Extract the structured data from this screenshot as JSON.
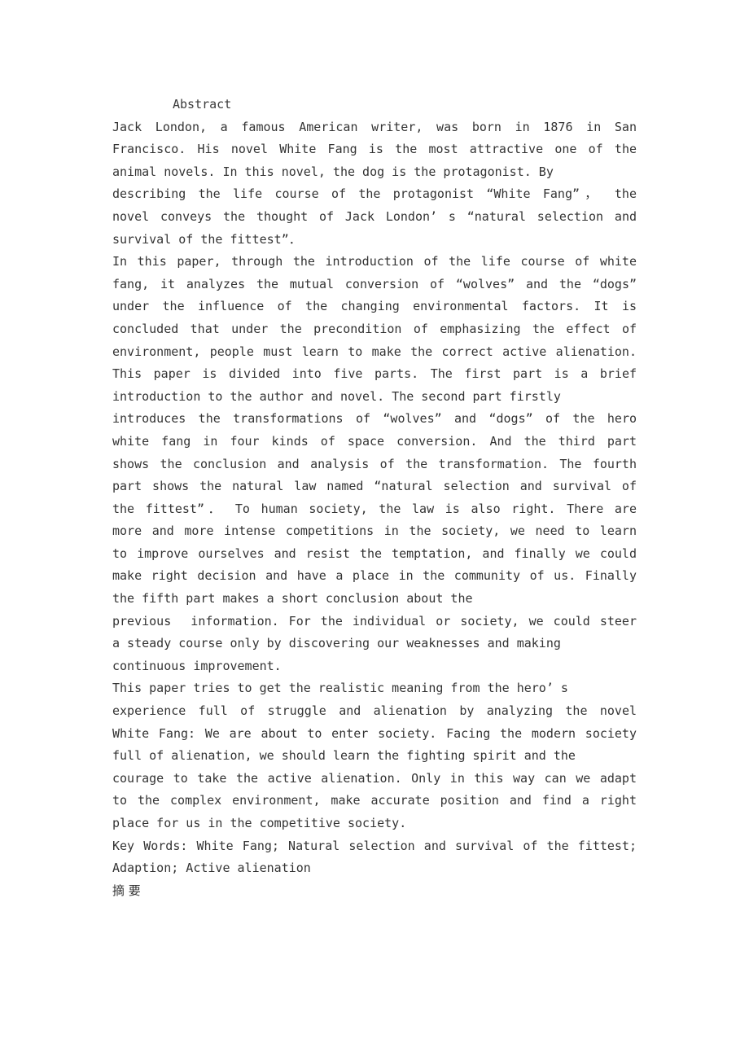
{
  "document": {
    "heading": "Abstract",
    "heading_indent_spaces": "      ",
    "lines": [
      {
        "text": "Jack London, a famous American writer, was born in 1876 in San",
        "justified": true
      },
      {
        "text": "Francisco. His novel White Fang is the most attractive one of the",
        "justified": true
      },
      {
        "text": "animal novels. In this novel, the dog is the protagonist. By",
        "justified": false
      },
      {
        "text": "describing the life course of the protagonist “White Fang”， the",
        "justified": true
      },
      {
        "text": "novel conveys the thought of Jack London’ s “natural selection and",
        "justified": true
      },
      {
        "text": "survival of the fittest”．",
        "justified": false
      },
      {
        "text": "In this paper, through the introduction of the life course of white",
        "justified": true
      },
      {
        "text": "fang, it analyzes the mutual conversion of “wolves” and the “dogs”",
        "justified": true
      },
      {
        "text": "under the influence of the changing environmental factors. It is",
        "justified": true
      },
      {
        "text": "concluded that under the precondition of emphasizing the effect of",
        "justified": true
      },
      {
        "text": "environment, people must learn to make the correct active alienation.",
        "justified": true
      },
      {
        "text": "This paper is divided into five parts. The first part is a brief",
        "justified": true
      },
      {
        "text": "introduction to the author and novel. The second part firstly",
        "justified": false
      },
      {
        "text": "introduces the transformations of “wolves” and “dogs” of the hero",
        "justified": true
      },
      {
        "text": "white fang in four kinds of space conversion. And the third part",
        "justified": true
      },
      {
        "text": "shows the conclusion and analysis of the transformation. The fourth",
        "justified": true
      },
      {
        "text": "part shows the natural law named “natural selection and survival of",
        "justified": true
      },
      {
        "text": "the fittest”． To human society, the law is also right. There are",
        "justified": true
      },
      {
        "text": "more and more intense competitions in the society, we need to learn",
        "justified": true
      },
      {
        "text": "to improve ourselves and resist the temptation, and finally we could",
        "justified": true
      },
      {
        "text": "make right decision and have a place in the community of us. Finally",
        "justified": true
      },
      {
        "text": "the fifth part makes a short conclusion about the",
        "justified": false
      },
      {
        "text": "previous  information. For the individual or society, we could steer",
        "justified": true
      },
      {
        "text": "a steady course only by discovering our weaknesses and making",
        "justified": false
      },
      {
        "text": "continuous improvement.",
        "justified": false
      },
      {
        "text": "This paper tries to get the realistic meaning from the hero’ s",
        "justified": false
      },
      {
        "text": "experience full of struggle and alienation by analyzing the novel",
        "justified": true
      },
      {
        "text": "White Fang: We are about to enter society. Facing the modern society",
        "justified": true
      },
      {
        "text": "full of alienation, we should learn the fighting spirit and the",
        "justified": false
      },
      {
        "text": "courage to take the active alienation. Only in this way can we adapt",
        "justified": true
      },
      {
        "text": "to the complex environment, make accurate position and find a right",
        "justified": true
      },
      {
        "text": "place for us in the competitive society.",
        "justified": false
      },
      {
        "text": "Key Words: White Fang; Natural selection and survival of the fittest;",
        "justified": true
      },
      {
        "text": "Adaption; Active alienation",
        "justified": false
      }
    ],
    "cjk_heading": "摘 要"
  }
}
